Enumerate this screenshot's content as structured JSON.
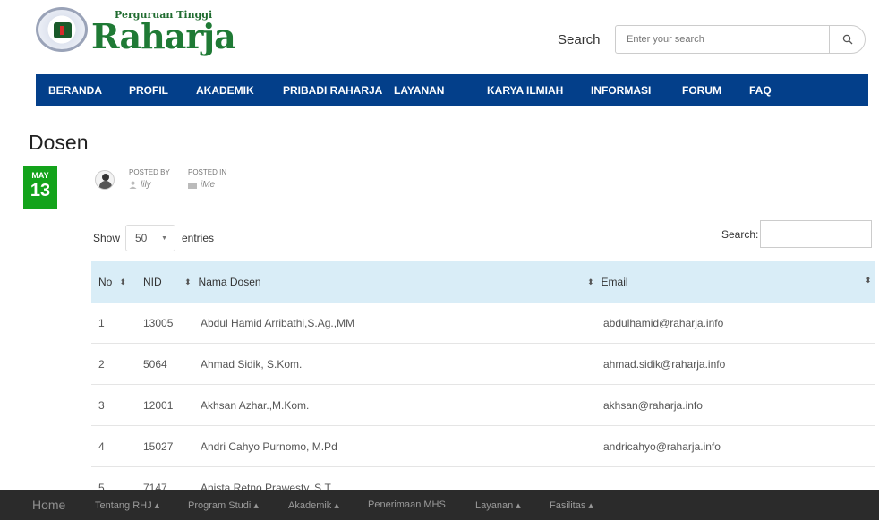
{
  "header": {
    "logo_small": "Perguruan Tinggi",
    "logo_big": "Raharja",
    "search_label": "Search",
    "search_placeholder": "Enter your search"
  },
  "nav": {
    "items": [
      "BERANDA",
      "PROFIL",
      "AKADEMIK",
      "PRIBADI RAHARJA",
      "LAYANAN",
      "KARYA ILMIAH",
      "INFORMASI",
      "FORUM",
      "FAQ"
    ]
  },
  "page": {
    "title": "Dosen",
    "date_month": "MAY",
    "date_day": "13",
    "posted_by_label": "POSTED BY",
    "posted_by": "lily",
    "posted_in_label": "POSTED IN",
    "posted_in": "iMe"
  },
  "table_controls": {
    "show_label": "Show",
    "show_value": "50",
    "entries_label": "entries",
    "search_label": "Search:"
  },
  "table": {
    "headers": [
      "No",
      "NID",
      "Nama Dosen",
      "Email"
    ],
    "rows": [
      {
        "no": "1",
        "nid": "13005",
        "nama": "Abdul Hamid Arribathi,S.Ag.,MM",
        "email": "abdulhamid@raharja.info"
      },
      {
        "no": "2",
        "nid": "5064",
        "nama": "Ahmad Sidik, S.Kom.",
        "email": "ahmad.sidik@raharja.info"
      },
      {
        "no": "3",
        "nid": "12001",
        "nama": "Akhsan Azhar.,M.Kom.",
        "email": "akhsan@raharja.info"
      },
      {
        "no": "4",
        "nid": "15027",
        "nama": "Andri Cahyo Purnomo, M.Pd",
        "email": "andricahyo@raharja.info"
      },
      {
        "no": "5",
        "nid": "7147",
        "nama": "Anista Retno Prawesty, S.T",
        "email": ""
      }
    ]
  },
  "footer": {
    "home": "Home",
    "items": [
      "Tentang RHJ ▴",
      "Program Studi ▴",
      "Akademik ▴",
      "Penerimaan MHS",
      "Layanan ▴",
      "Fasilitas ▴"
    ]
  },
  "colors": {
    "nav_bg": "#033f8a",
    "badge_green": "#13a31b",
    "table_header_bg": "#d9edf7",
    "footer_bg": "#2b2b2b",
    "logo_green": "#1f7a35"
  }
}
